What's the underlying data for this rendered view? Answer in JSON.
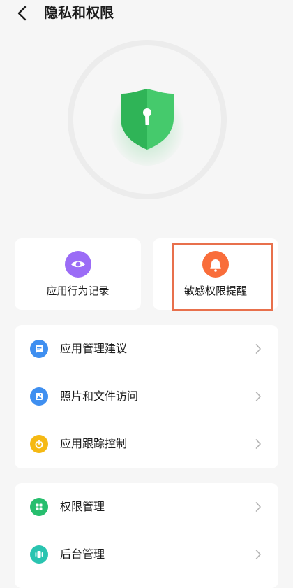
{
  "header": {
    "title": "隐私和权限",
    "back_icon": "chevron-left-icon"
  },
  "hero": {
    "icon": "shield-keyhole-icon",
    "color": "#3cc463"
  },
  "quick_actions": [
    {
      "label": "应用行为记录",
      "icon": "eye-icon",
      "color": "#9b6cf6"
    },
    {
      "label": "敏感权限提醒",
      "icon": "bell-icon",
      "color": "#f96d3a",
      "highlighted": true
    }
  ],
  "group_one": [
    {
      "label": "应用管理建议",
      "icon": "message-icon",
      "color": "#3f8ff0"
    },
    {
      "label": "照片和文件访问",
      "icon": "image-icon",
      "color": "#3f8ff0"
    },
    {
      "label": "应用跟踪控制",
      "icon": "power-icon",
      "color": "#f5b914"
    }
  ],
  "group_two": [
    {
      "label": "权限管理",
      "icon": "grid-icon",
      "color": "#27be6e"
    },
    {
      "label": "后台管理",
      "icon": "app-stack-icon",
      "color": "#2ac4b0"
    }
  ],
  "highlight_color": "#e8704c"
}
